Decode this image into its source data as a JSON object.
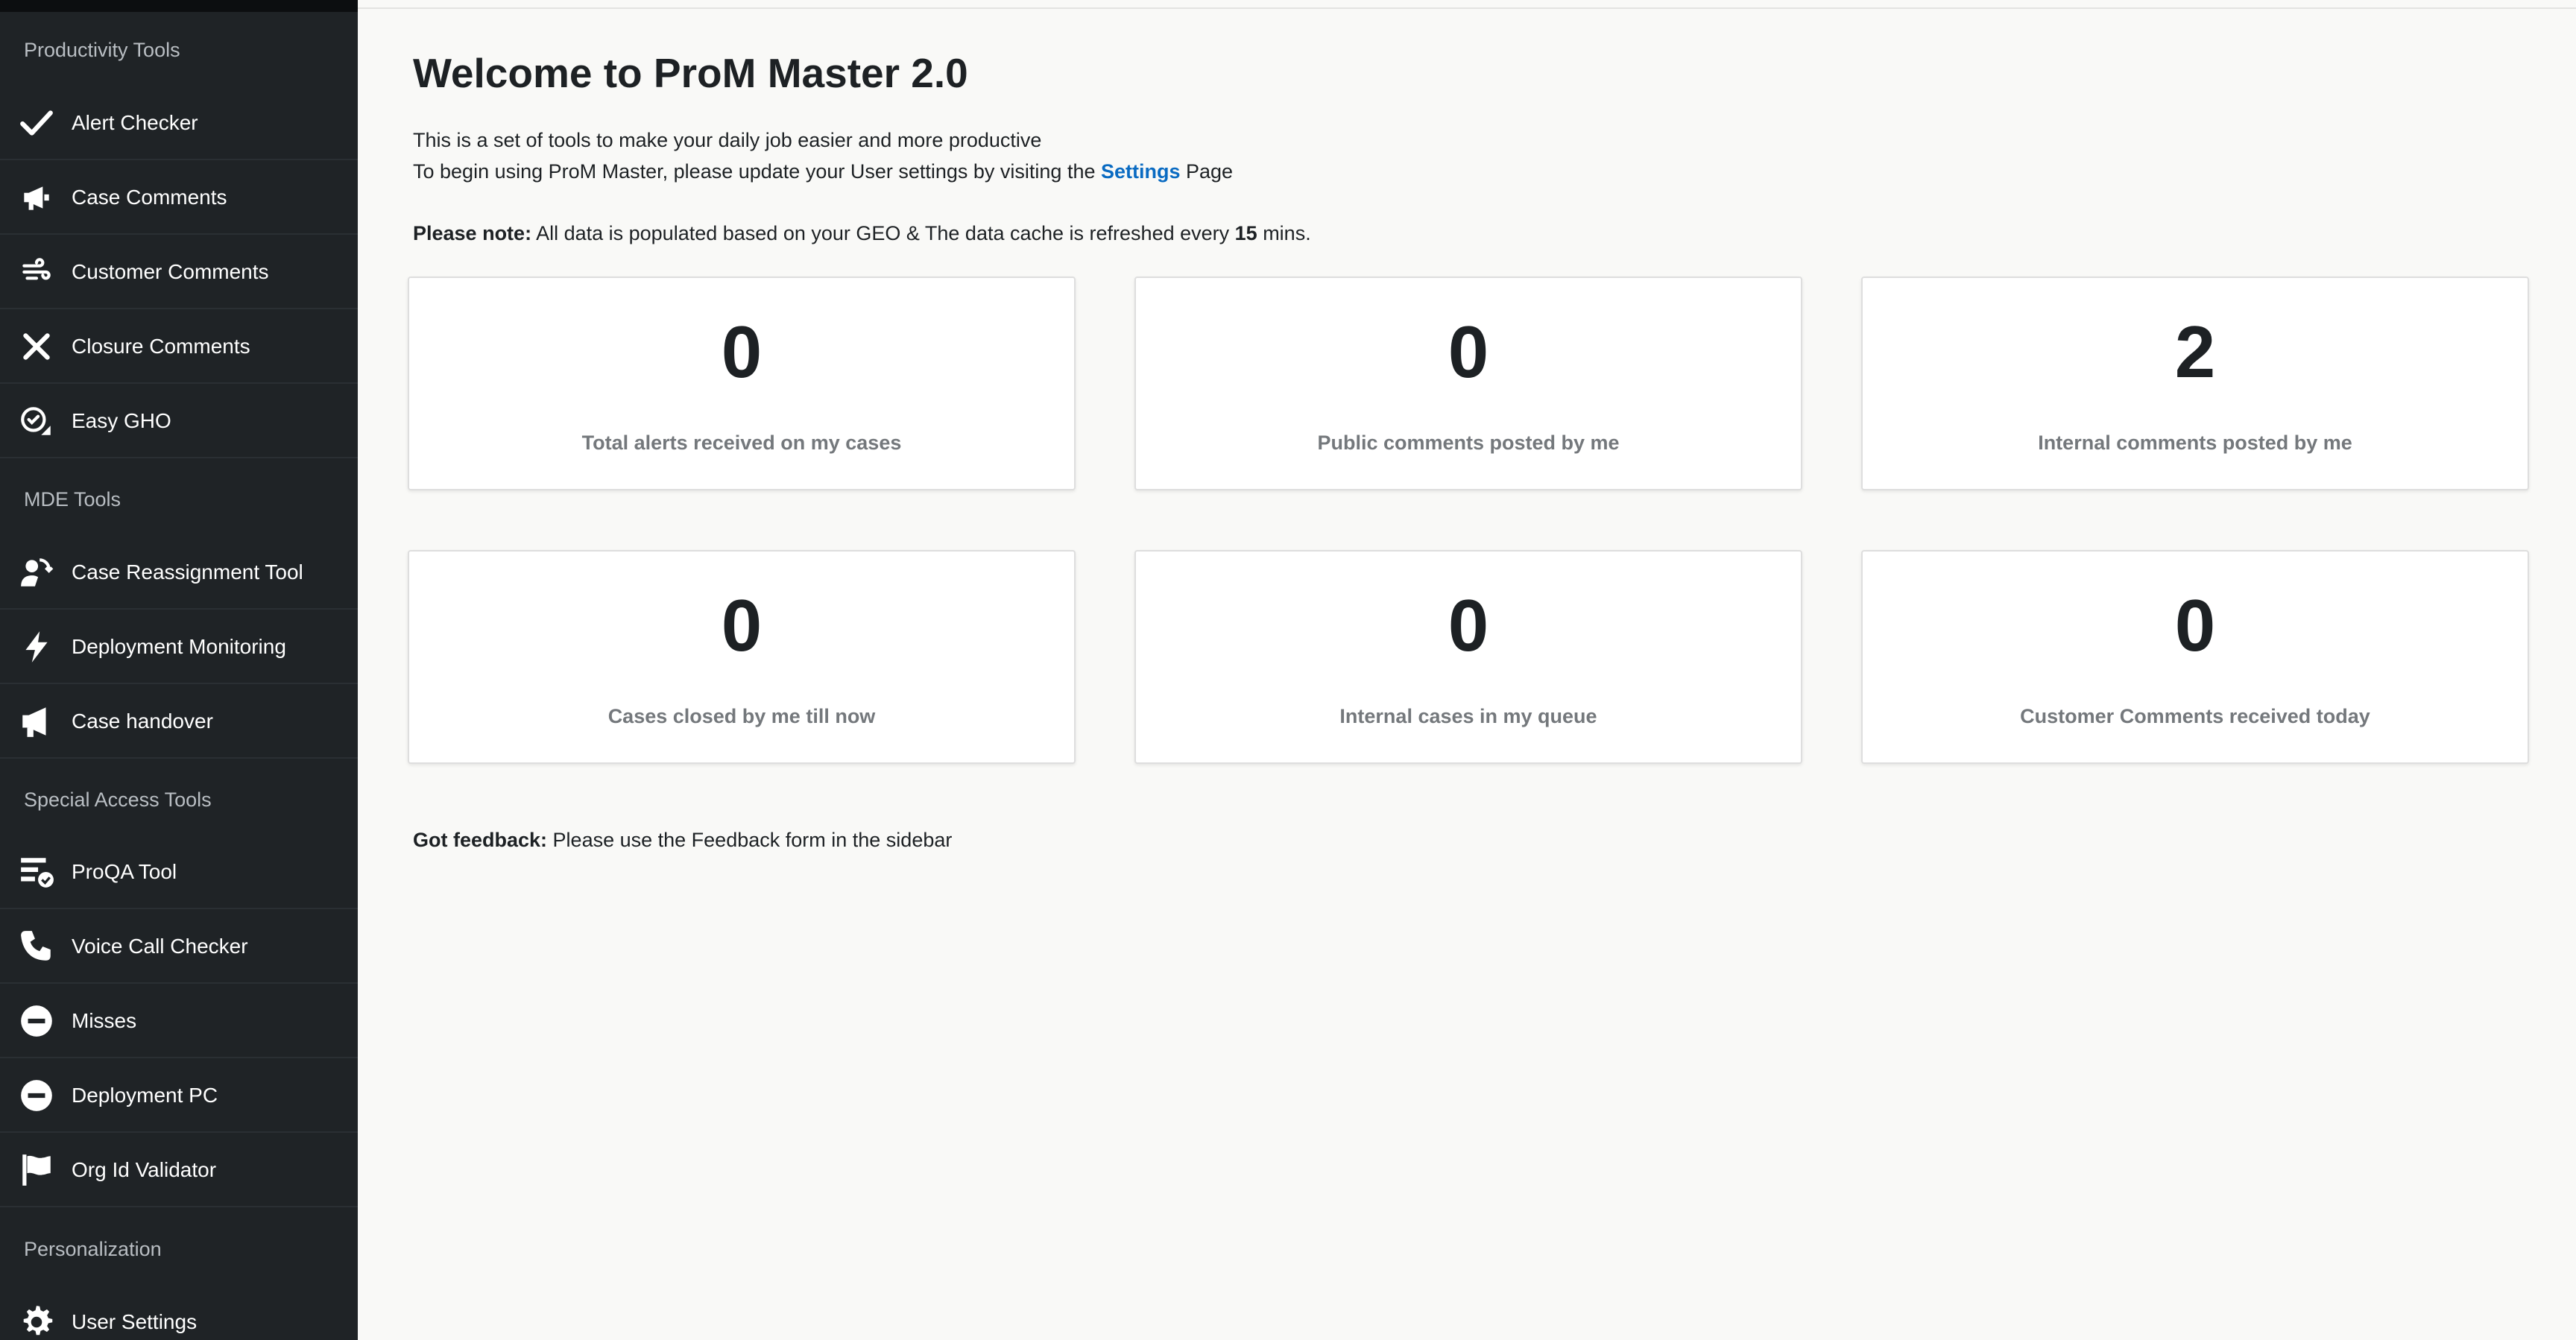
{
  "sidebar": {
    "sections": [
      {
        "title": "Productivity Tools",
        "items": [
          {
            "label": "Alert Checker",
            "icon": "checkmark-icon"
          },
          {
            "label": "Case Comments",
            "icon": "megaphone-icon"
          },
          {
            "label": "Customer Comments",
            "icon": "wind-icon"
          },
          {
            "label": "Closure Comments",
            "icon": "close-icon"
          },
          {
            "label": "Easy GHO",
            "icon": "badge-check-icon"
          }
        ]
      },
      {
        "title": "MDE Tools",
        "items": [
          {
            "label": "Case Reassignment Tool",
            "icon": "user-rotate-icon"
          },
          {
            "label": "Deployment Monitoring",
            "icon": "bolt-icon"
          },
          {
            "label": "Case handover",
            "icon": "megaphone-icon"
          }
        ]
      },
      {
        "title": "Special Access Tools",
        "items": [
          {
            "label": "ProQA Tool",
            "icon": "list-check-icon"
          },
          {
            "label": "Voice Call Checker",
            "icon": "phone-icon"
          },
          {
            "label": "Misses",
            "icon": "minus-circle-icon"
          },
          {
            "label": "Deployment PC",
            "icon": "minus-circle-icon"
          },
          {
            "label": "Org Id Validator",
            "icon": "flag-icon"
          }
        ]
      },
      {
        "title": "Personalization",
        "items": [
          {
            "label": "User Settings",
            "icon": "gear-icon"
          }
        ]
      }
    ]
  },
  "main": {
    "title": "Welcome to ProM Master 2.0",
    "intro_line1": "This is a set of tools to make your daily job easier and more productive",
    "intro_line2_pre": "To begin using ProM Master, please update your User settings by visiting the ",
    "settings_link": "Settings",
    "intro_line2_post": " Page",
    "note_label": "Please note:",
    "note_text_pre": " All data is populated based on your GEO & The data cache is refreshed every ",
    "note_minutes": "15",
    "note_text_post": " mins.",
    "cards": [
      {
        "value": "0",
        "caption": "Total alerts received on my cases"
      },
      {
        "value": "0",
        "caption": "Public comments posted by me"
      },
      {
        "value": "2",
        "caption": "Internal comments posted by me"
      },
      {
        "value": "0",
        "caption": "Cases closed by me till now"
      },
      {
        "value": "0",
        "caption": "Internal cases in my queue"
      },
      {
        "value": "0",
        "caption": "Customer Comments received today"
      }
    ],
    "feedback_label": "Got feedback:",
    "feedback_text": " Please use the Feedback form in the sidebar"
  },
  "colors": {
    "sidebar_bg": "#1f2326",
    "main_bg": "#f9f9f7",
    "link": "#0a6bc2",
    "caption": "#74787c"
  }
}
